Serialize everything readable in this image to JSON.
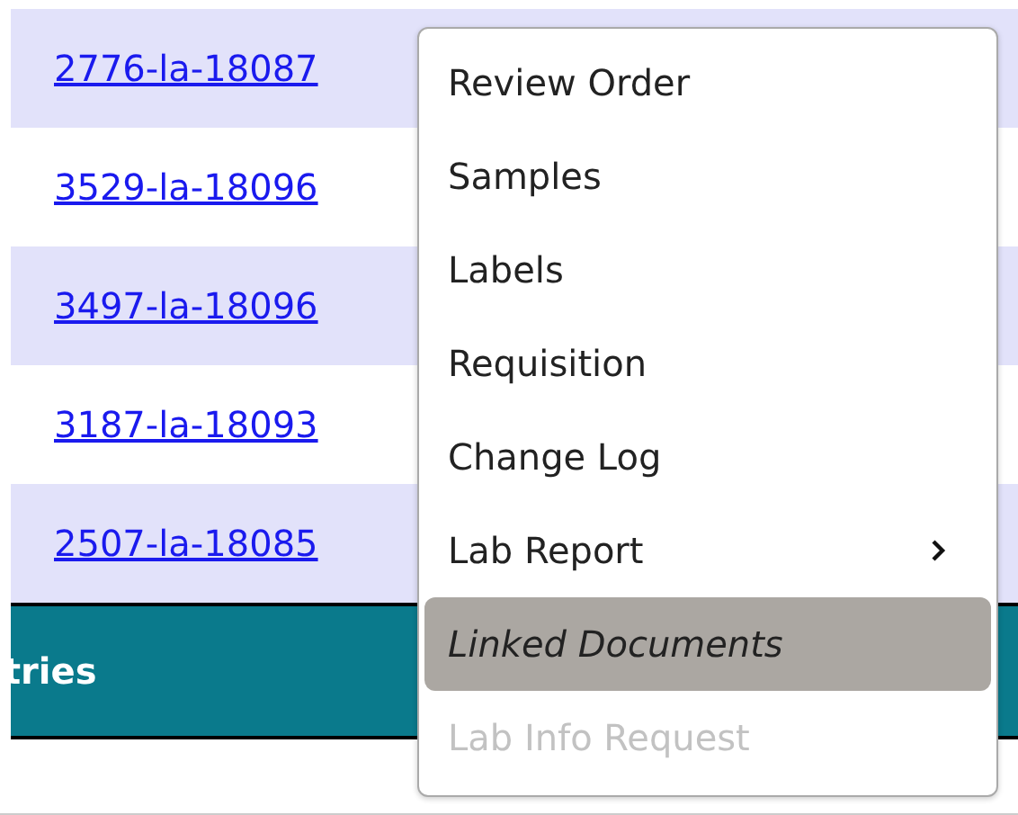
{
  "table": {
    "rows": [
      {
        "order_id": "2776-la-18087"
      },
      {
        "order_id": "3529-la-18096"
      },
      {
        "order_id": "3497-la-18096"
      },
      {
        "order_id": "3187-la-18093"
      },
      {
        "order_id": "2507-la-18085"
      }
    ],
    "footer": {
      "text": "tries"
    }
  },
  "context_menu": {
    "items": [
      {
        "label": "Review Order",
        "selected": false,
        "disabled": false,
        "submenu": false
      },
      {
        "label": "Samples",
        "selected": false,
        "disabled": false,
        "submenu": false
      },
      {
        "label": "Labels",
        "selected": false,
        "disabled": false,
        "submenu": false
      },
      {
        "label": "Requisition",
        "selected": false,
        "disabled": false,
        "submenu": false
      },
      {
        "label": "Change Log",
        "selected": false,
        "disabled": false,
        "submenu": false
      },
      {
        "label": "Lab Report",
        "selected": false,
        "disabled": false,
        "submenu": true
      },
      {
        "label": "Linked Documents",
        "selected": true,
        "disabled": false,
        "submenu": false
      },
      {
        "label": "Lab Info Request",
        "selected": false,
        "disabled": true,
        "submenu": false
      }
    ]
  }
}
